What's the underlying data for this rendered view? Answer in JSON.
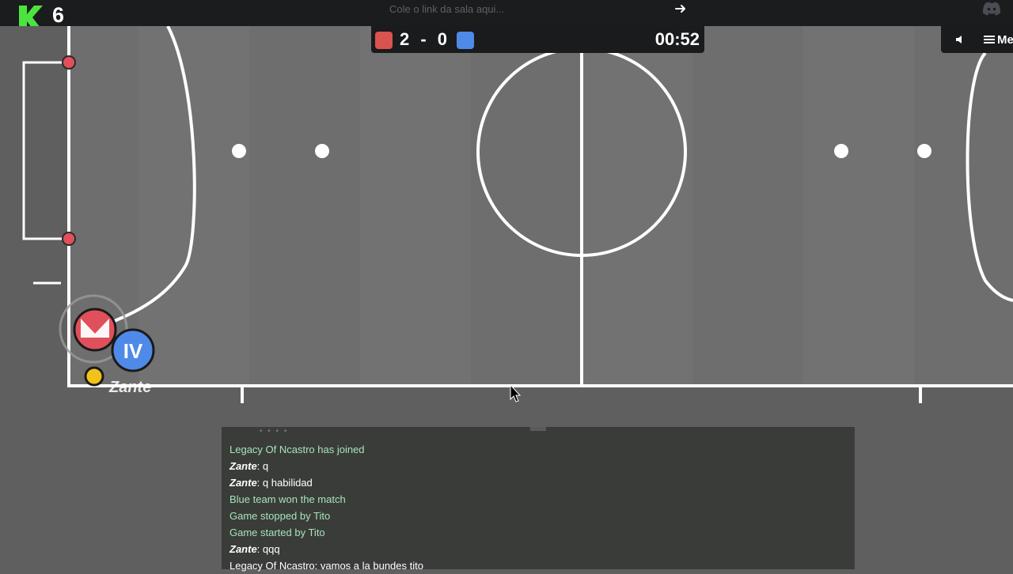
{
  "brand": {
    "count": "6"
  },
  "top": {
    "room_link_placeholder": "Cole o link da sala aqui...",
    "go_icon": "arrow-right-icon",
    "discord_icon": "discord-icon"
  },
  "scoreboard": {
    "score": "2 - 0",
    "red_score": 2,
    "blue_score": 0,
    "time": "00:52",
    "red_color": "#d9534f",
    "blue_color": "#4f8ae8"
  },
  "controls": {
    "sound_icon": "speaker-icon",
    "menu_label": "Me"
  },
  "players": [
    {
      "team": "red",
      "avatar": ""
    },
    {
      "team": "blue",
      "avatar": "IV",
      "name": "Zante"
    }
  ],
  "chat": [
    {
      "kind": "sys",
      "text": "Legacy Of Ncastro has joined"
    },
    {
      "kind": "msg",
      "author": "Zante",
      "text": ": q"
    },
    {
      "kind": "msg",
      "author": "Zante",
      "text": ": q habilidad"
    },
    {
      "kind": "sys",
      "text": "Blue team won the match"
    },
    {
      "kind": "sys",
      "text": "Game stopped by Tito"
    },
    {
      "kind": "sys",
      "text": "Game started by Tito"
    },
    {
      "kind": "msg",
      "author": "Zante",
      "text": ": qqq"
    },
    {
      "kind": "msg",
      "author": "",
      "text": "Legacy Of Ncastro: vamos a la bundes tito"
    }
  ],
  "colors": {
    "field": "#6e6e6e",
    "lines": "#ffffff",
    "post": "#e0505a",
    "ball": "#f2c21b",
    "brand_green": "#4ce33f"
  }
}
